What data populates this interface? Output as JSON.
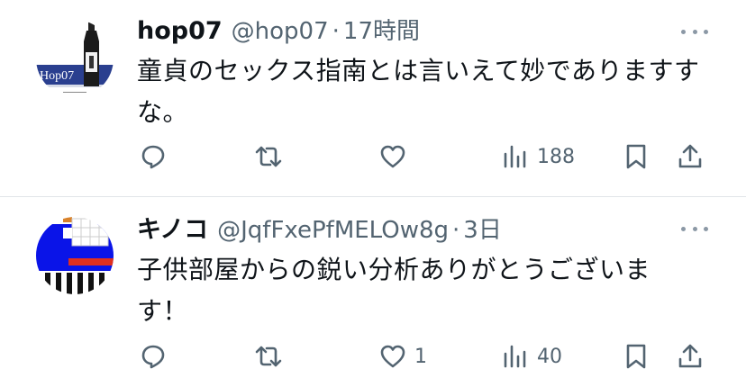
{
  "tweets": [
    {
      "name": "hop07",
      "handle": "@hop07",
      "separator": "·",
      "time": "17時間",
      "text_line1": "童貞のセックス指南とは言いえて妙でありますす",
      "text_line2": "な。",
      "avatar_label": "Hop07",
      "actions": {
        "reply": "",
        "retweet": "",
        "like": "",
        "views": "188"
      }
    },
    {
      "name": "キノコ",
      "handle": "@JqfFxePfMELOw8g",
      "separator": "·",
      "time": "3日",
      "text_line1": "子供部屋からの鋭い分析ありがとうございま",
      "text_line2": "す！",
      "actions": {
        "reply": "",
        "retweet": "",
        "like": "1",
        "views": "40"
      }
    }
  ],
  "colors": {
    "text": "#0f1419",
    "muted": "#536471",
    "divider": "#e1e5e8"
  }
}
